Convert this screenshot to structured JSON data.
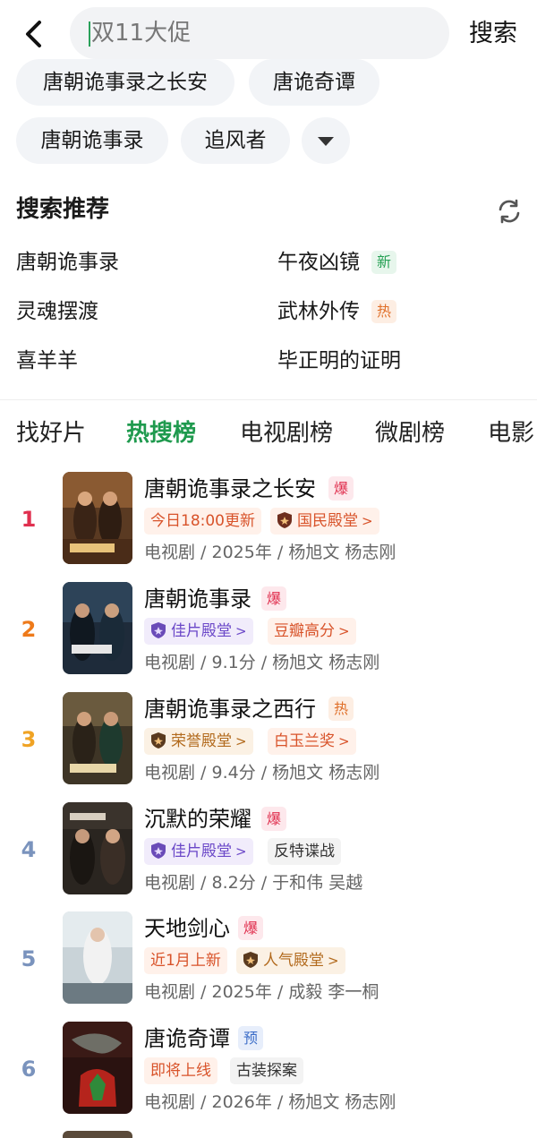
{
  "search": {
    "value": "双11大促",
    "button_label": "搜索"
  },
  "history": [
    "唐朝诡事录之长安",
    "唐诡奇谭",
    "唐朝诡事录",
    "追风者"
  ],
  "recommend": {
    "title": "搜索推荐",
    "items": [
      {
        "label": "唐朝诡事录",
        "tag": ""
      },
      {
        "label": "午夜凶镜",
        "tag": "新"
      },
      {
        "label": "灵魂摆渡",
        "tag": ""
      },
      {
        "label": "武林外传",
        "tag": "热"
      },
      {
        "label": "喜羊羊",
        "tag": ""
      },
      {
        "label": "毕正明的证明",
        "tag": ""
      }
    ]
  },
  "tabs": [
    "找好片",
    "热搜榜",
    "电视剧榜",
    "微剧榜",
    "电影"
  ],
  "active_tab": "热搜榜",
  "colors": {
    "accent": "#1f9a4e",
    "rank1": "#e0304f",
    "rank2": "#ee7a1a",
    "rank3": "#f0a324",
    "rank_other": "#7a93bd"
  },
  "rankings": [
    {
      "rank": "1",
      "title": "唐朝诡事录之长安",
      "flag": "爆",
      "pills": [
        "今日18:00更新",
        "国民殿堂"
      ],
      "meta": "电视剧 / 2025年 / 杨旭文 杨志刚"
    },
    {
      "rank": "2",
      "title": "唐朝诡事录",
      "flag": "爆",
      "pills": [
        "佳片殿堂",
        "豆瓣高分"
      ],
      "meta": "电视剧 / 9.1分 / 杨旭文 杨志刚"
    },
    {
      "rank": "3",
      "title": "唐朝诡事录之西行",
      "flag": "热",
      "pills": [
        "荣誉殿堂",
        "白玉兰奖"
      ],
      "meta": "电视剧 / 9.4分 / 杨旭文 杨志刚"
    },
    {
      "rank": "4",
      "title": "沉默的荣耀",
      "flag": "爆",
      "pills": [
        "佳片殿堂",
        "反特谍战"
      ],
      "meta": "电视剧 / 8.2分 / 于和伟 吴越"
    },
    {
      "rank": "5",
      "title": "天地剑心",
      "flag": "爆",
      "pills": [
        "近1月上新",
        "人气殿堂"
      ],
      "meta": "电视剧 / 2025年 / 成毅 李一桐"
    },
    {
      "rank": "6",
      "title": "唐诡奇谭",
      "flag": "预",
      "pills": [
        "即将上线",
        "古装探案"
      ],
      "meta": "电视剧 / 2026年 / 杨旭文 杨志刚"
    }
  ]
}
